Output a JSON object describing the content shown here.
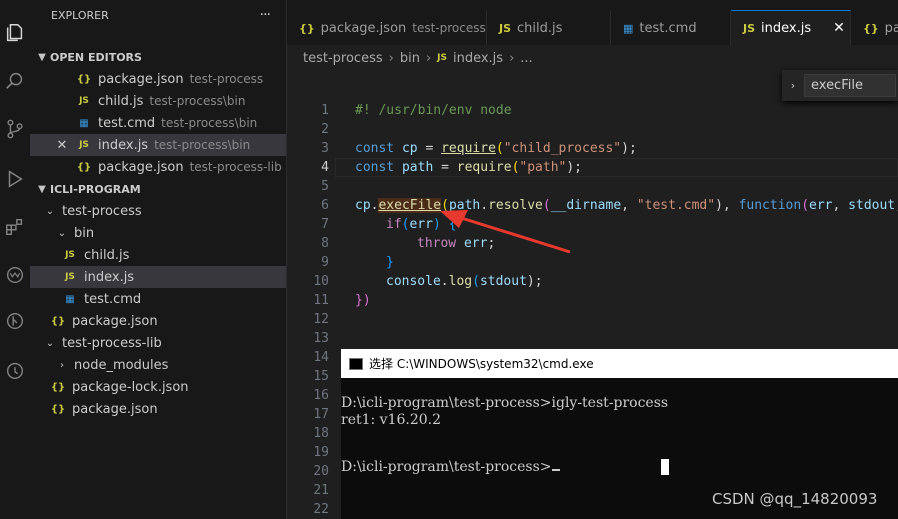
{
  "sidebar": {
    "title": "EXPLORER",
    "more": "···",
    "open_editors_title": "OPEN EDITORS",
    "open_editors": [
      {
        "icon": "{}",
        "name": "package.json",
        "desc": "test-process"
      },
      {
        "icon": "JS",
        "name": "child.js",
        "desc": "test-process\\bin"
      },
      {
        "icon": "cmd",
        "name": "test.cmd",
        "desc": "test-process\\bin"
      },
      {
        "icon": "JS",
        "name": "index.js",
        "desc": "test-process\\bin"
      },
      {
        "icon": "{}",
        "name": "package.json",
        "desc": "test-process-lib"
      }
    ],
    "project_title": "ICLI-PROGRAM",
    "tree": [
      {
        "name": "test-process"
      },
      {
        "name": "bin"
      },
      {
        "name": "child.js"
      },
      {
        "name": "index.js"
      },
      {
        "name": "test.cmd"
      },
      {
        "name": "package.json"
      },
      {
        "name": "test-process-lib"
      },
      {
        "name": "node_modules"
      },
      {
        "name": "package-lock.json"
      },
      {
        "name": "package.json"
      }
    ]
  },
  "tabs": [
    {
      "label": "package.json",
      "desc": "test-process"
    },
    {
      "label": "child.js"
    },
    {
      "label": "test.cmd"
    },
    {
      "label": "index.js"
    },
    {
      "label": "pa"
    }
  ],
  "breadcrumb": [
    "test-process",
    "bin",
    "index.js",
    "..."
  ],
  "find": {
    "value": "execFile"
  },
  "line_numbers": [
    "1",
    "2",
    "3",
    "4",
    "5",
    "6",
    "7",
    "8",
    "9",
    "10",
    "11",
    "12",
    "13",
    "14",
    "15",
    "16",
    "17",
    "18",
    "19",
    "20",
    "21",
    "22"
  ],
  "code": {
    "l1": "#! /usr/bin/env node",
    "l3": [
      "const",
      " ",
      "cp",
      " = ",
      "require",
      "(",
      "\"child_process\"",
      ");"
    ],
    "l4": [
      "const",
      " ",
      "path",
      " = ",
      "require",
      "(",
      "\"path\"",
      ");"
    ],
    "l6": [
      "cp",
      ".",
      "execFile",
      "(",
      "path",
      ".",
      "resolve",
      "(",
      "__dirname",
      ", ",
      "\"test.cmd\"",
      "), ",
      "function",
      "(",
      "err",
      ", ",
      "stdout",
      ","
    ],
    "l7": [
      "if",
      "(",
      "err",
      ") {"
    ],
    "l8": [
      "throw",
      " ",
      "err",
      ";"
    ],
    "l9": "}",
    "l10": [
      "console",
      ".",
      "log",
      "(",
      "stdout",
      ");"
    ],
    "l11": "})"
  },
  "cmd": {
    "title": "选择 C:\\WINDOWS\\system32\\cmd.exe",
    "line1": "D:\\icli-program\\test-process>igly-test-process",
    "line2": "ret1: v16.20.2",
    "line3": "D:\\icli-program\\test-process>"
  },
  "watermark": "CSDN @qq_14820093",
  "colors": {
    "accent": "#0078d4",
    "arrow": "#e8392f"
  }
}
